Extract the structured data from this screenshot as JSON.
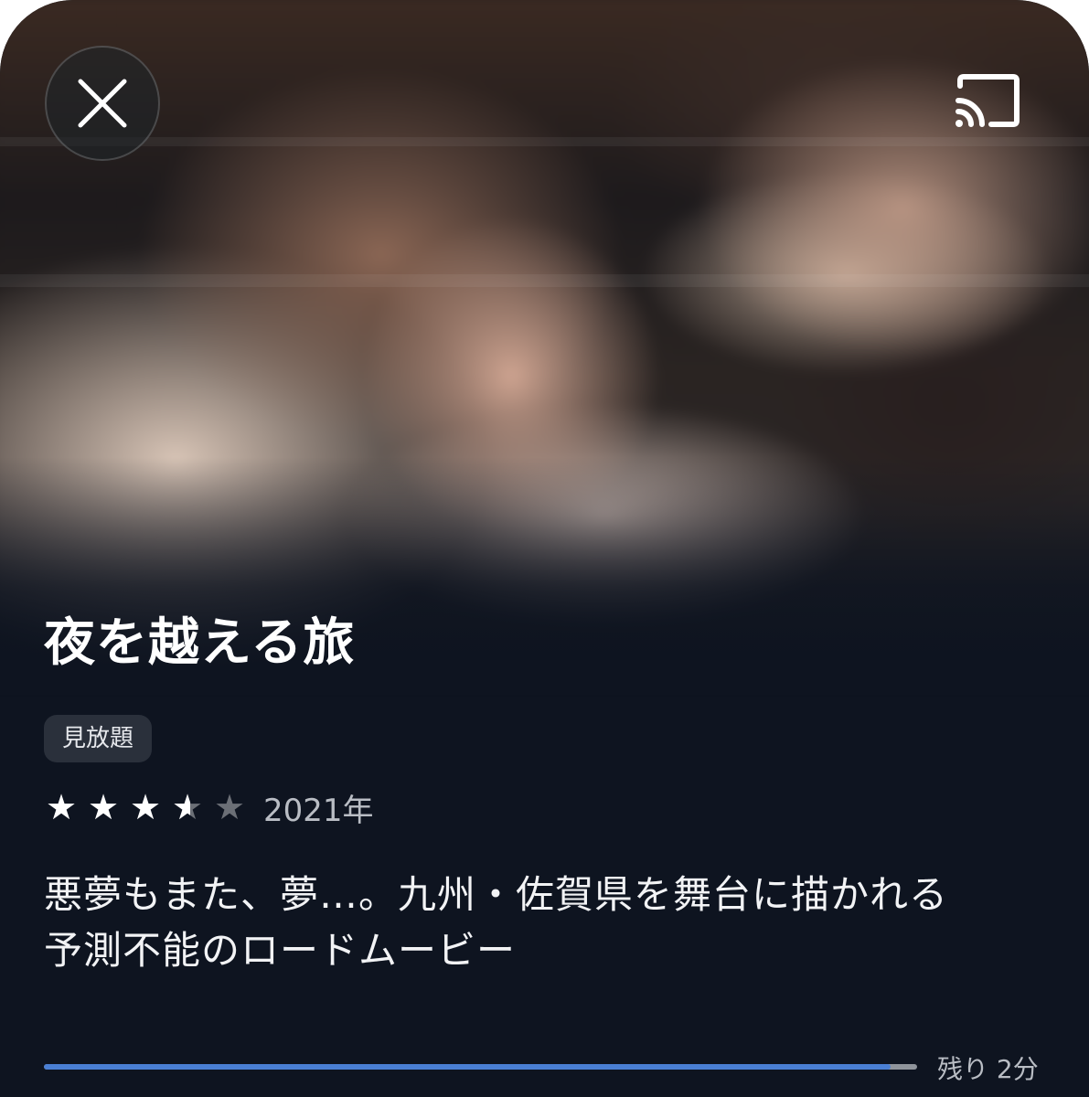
{
  "header": {
    "close_icon": "close-x-icon",
    "cast_icon": "cast-icon"
  },
  "content": {
    "title": "夜を越える旅",
    "badge": "見放題",
    "rating": 3.5,
    "rating_max": 5,
    "year": "2021年",
    "synopsis_line1": "悪夢もまた、夢…。九州・佐賀県を舞台に描かれる",
    "synopsis_line2": "予測不能のロードムービー"
  },
  "playback": {
    "progress": 0.97,
    "remaining_label": "残り 2分"
  },
  "colors": {
    "background": "#0e1420",
    "progress_fill": "#4a7fd4",
    "progress_track": "#8f949b",
    "badge_bg": "#2a303b",
    "star_on": "#ffffff",
    "star_off": "#6b6f76"
  }
}
